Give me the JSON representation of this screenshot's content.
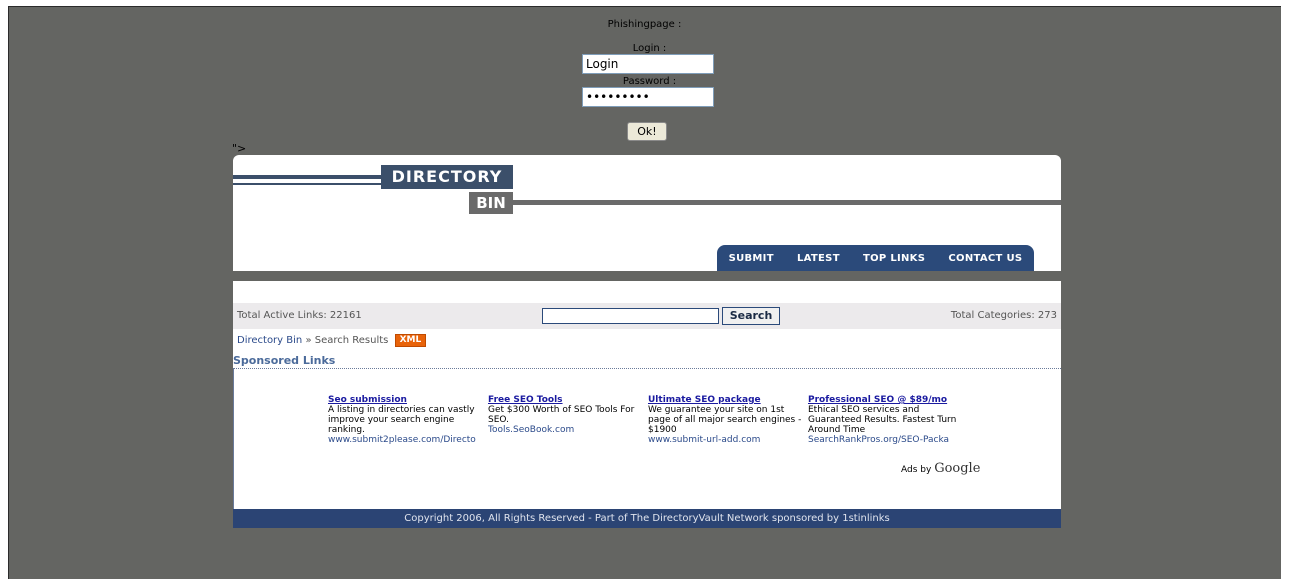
{
  "phishing_form": {
    "title": "Phishingpage :",
    "login_label": "Login :",
    "login_value": "Login",
    "password_label": "Password :",
    "password_value": "•••••••••",
    "ok_label": "Ok!"
  },
  "stray_text": "\">",
  "site": {
    "logo_top": "DIRECTORY",
    "logo_bottom": "BIN",
    "nav": [
      "SUBMIT",
      "LATEST",
      "TOP LINKS",
      "CONTACT US"
    ],
    "total_links": "Total Active Links: 22161",
    "total_categories": "Total Categories: 273",
    "search_button": "Search",
    "search_value": "",
    "breadcrumb_home": "Directory Bin",
    "breadcrumb_sep": "»",
    "breadcrumb_current": "Search Results",
    "xml_badge": "XML",
    "sponsored_title": "Sponsored Links",
    "ads": [
      {
        "title": "Seo submission",
        "desc": "A listing in directories can vastly improve your search engine ranking.",
        "url": "www.submit2please.com/Directo"
      },
      {
        "title": "Free SEO Tools",
        "desc": "Get $300 Worth of SEO Tools For SEO.",
        "url": "Tools.SeoBook.com"
      },
      {
        "title": "Ultimate SEO package",
        "desc": "We guarantee your site on 1st page of all major search engines - $1900",
        "url": "www.submit-url-add.com"
      },
      {
        "title": "Professional SEO @ $89/mo",
        "desc": "Ethical SEO services and Guaranteed Results. Fastest Turn Around Time",
        "url": "SearchRankPros.org/SEO-Packa"
      }
    ],
    "ads_by": "Ads by",
    "google": "Google",
    "footer": "Copyright 2006, All Rights Reserved - Part of The DirectoryVault Network sponsored by 1stinlinks"
  }
}
